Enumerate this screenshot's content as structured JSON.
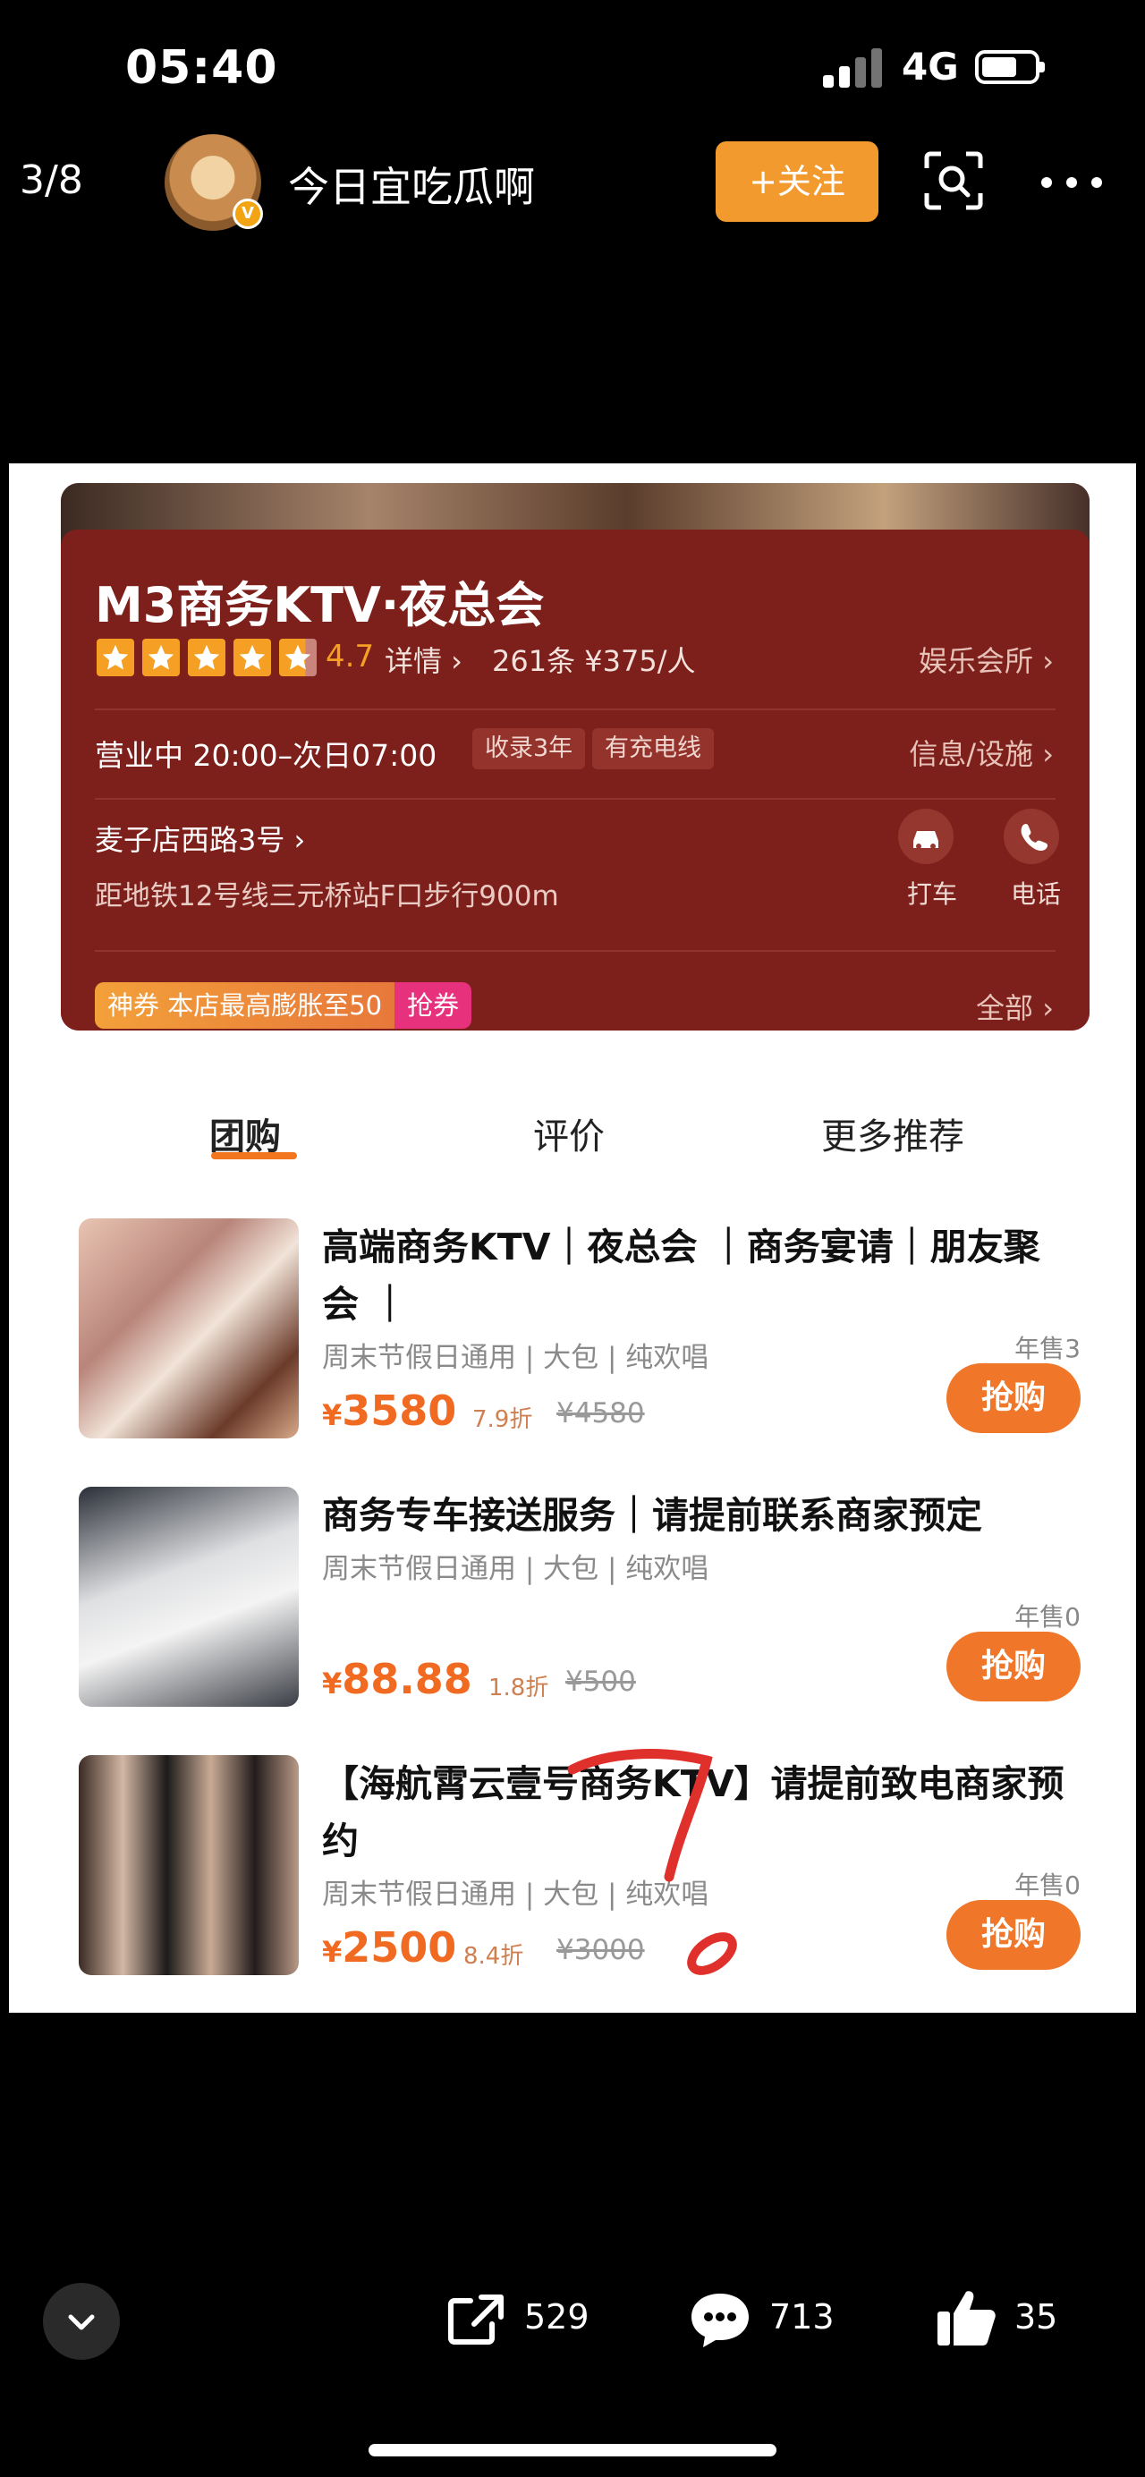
{
  "status_bar": {
    "time": "05:40",
    "network": "4G"
  },
  "header": {
    "page_count": "3/8",
    "username": "今日宜吃瓜啊",
    "follow_label": "+关注"
  },
  "shop": {
    "name": "M3商务KTV·夜总会",
    "rating": "4.7",
    "detail_link": "详情 ›",
    "reviews": "261条  ¥375/人",
    "category": "娱乐会所 ›",
    "hours": "营业中 20:00–次日07:00",
    "tags": [
      "收录3年",
      "有充电线"
    ],
    "facilities": "信息/设施 ›",
    "address": "麦子店西路3号 ›",
    "metro": "距地铁12号线三元桥站F口步行900m",
    "taxi_label": "打车",
    "phone_label": "电话",
    "coupon_text": "神券 本店最高膨胀至50",
    "coupon_grab": "抢券",
    "all_link": "全部 ›"
  },
  "tabs": [
    "团购",
    "评价",
    "更多推荐"
  ],
  "deals": [
    {
      "title": "高端商务KTV｜夜总会 ｜商务宴请｜朋友聚会 ｜",
      "meta": "周末节假日通用 | 大包 | 纯欢唱",
      "currency": "¥",
      "price": "3580",
      "discount": "7.9折",
      "original": "¥4580",
      "sales": "年售3",
      "buy_label": "抢购"
    },
    {
      "title": "商务专车接送服务｜请提前联系商家预定",
      "meta": "周末节假日通用 | 大包 | 纯欢唱",
      "currency": "¥",
      "price": "88.88",
      "discount": "1.8折",
      "original": "¥500",
      "sales": "年售0",
      "buy_label": "抢购"
    },
    {
      "title": "【海航霄云壹号商务KTV】请提前致电商家预约",
      "meta": "周末节假日通用 | 大包 | 纯欢唱",
      "currency": "¥",
      "price": "2500",
      "discount": "8.4折",
      "original": "¥3000",
      "sales": "年售0",
      "buy_label": "抢购"
    }
  ],
  "actions": {
    "share_count": "529",
    "comment_count": "713",
    "like_count": "35"
  },
  "colors": {
    "accent": "#f29a2e",
    "hero_bg": "#7d1f1b",
    "price": "#f06a22",
    "annotation": "#e0302c"
  }
}
